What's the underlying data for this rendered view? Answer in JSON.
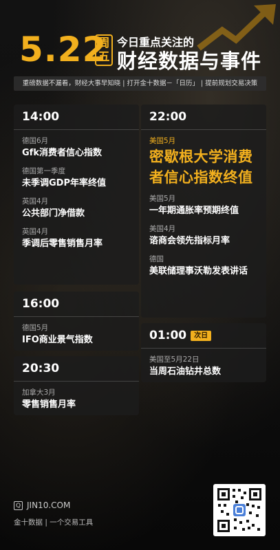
{
  "header": {
    "date": "5.22",
    "weekday_1": "周",
    "weekday_2": "五",
    "subtitle": "今日重点关注的",
    "title": "财经数据与事件",
    "tagline": "重磅数据不漏看，财经大事早知晓 | 打开金十数据－「日历」 | 提前规划交易决策"
  },
  "left_cards": [
    {
      "time": "14:00",
      "items": [
        {
          "country": "德国6月",
          "event": "Gfk消费者信心指数"
        },
        {
          "country": "德国第一季度",
          "event": "未季调GDP年率终值"
        },
        {
          "country": "英国4月",
          "event": "公共部门净借款"
        },
        {
          "country": "英国4月",
          "event": "季调后零售销售月率"
        }
      ]
    },
    {
      "time": "16:00",
      "items": [
        {
          "country": "德国5月",
          "event": "IFO商业景气指数"
        }
      ]
    },
    {
      "time": "20:30",
      "items": [
        {
          "country": "加拿大3月",
          "event": "零售销售月率"
        }
      ]
    }
  ],
  "right_cards": [
    {
      "time": "22:00",
      "badge": "",
      "items": [
        {
          "country": "美国5月",
          "event": "密歇根大学消费者信心指数终值",
          "highlight": true
        },
        {
          "country": "美国5月",
          "event": "一年期通胀率预期终值"
        },
        {
          "country": "美国4月",
          "event": "谘商会领先指标月率"
        },
        {
          "country": "德国",
          "event": "美联储理事沃勒发表讲话"
        }
      ]
    },
    {
      "time": "01:00",
      "badge": "次日",
      "items": [
        {
          "country": "美国至5月22日",
          "event": "当周石油钻井总数"
        }
      ]
    }
  ],
  "footer": {
    "logo_glyph": "Q",
    "site": "JIN10.COM",
    "tagline": "金十数据  |  一个交易工具"
  },
  "colors": {
    "accent": "#f2b01e",
    "card_bg": "#1c1c1c",
    "page_bg": "#0b0b0b"
  },
  "icons": [
    "up-arrow-icon",
    "logo-icon",
    "qr-code-icon"
  ]
}
